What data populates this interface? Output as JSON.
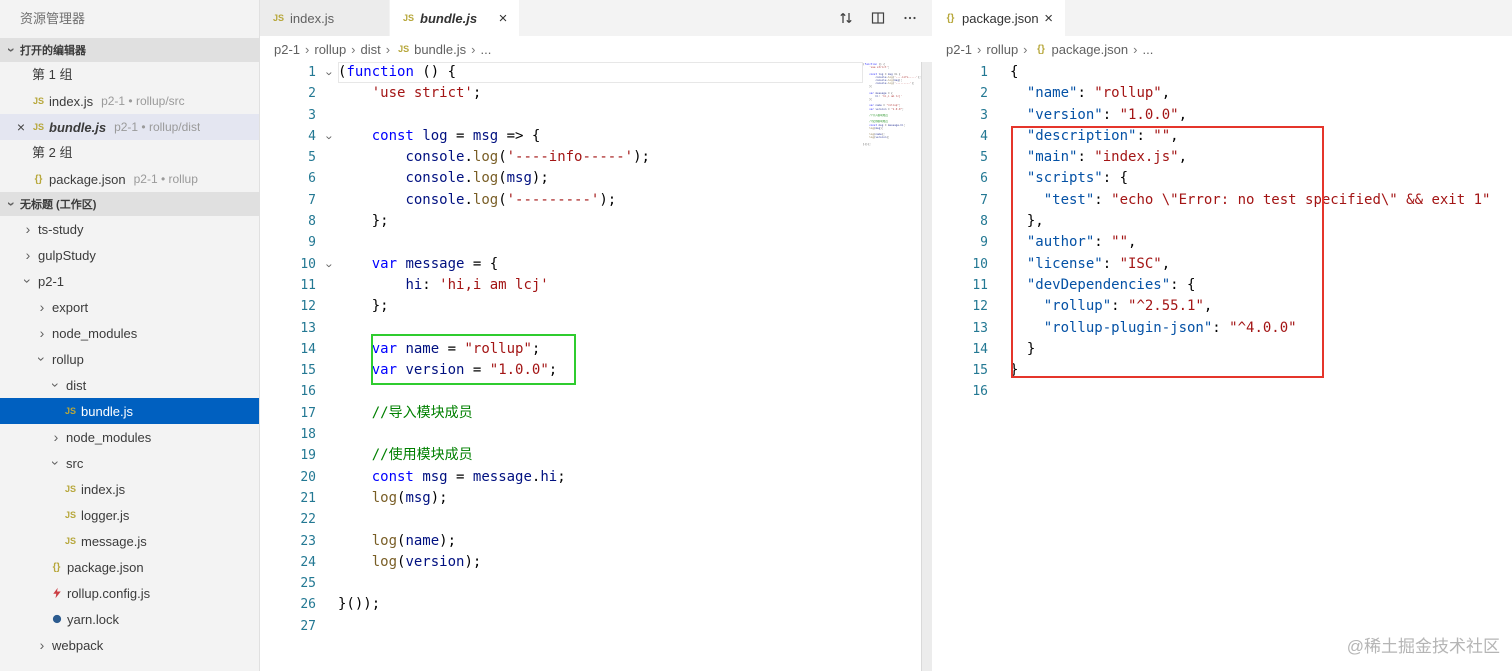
{
  "colors": {
    "accent": "#0060c0",
    "selected_row_bg": "#0060c0",
    "inactive_selection_bg": "#e4e6f1",
    "green_box": "#2fcc2f",
    "red_box": "#e5352b",
    "keyword": "#0000ff",
    "string": "#a31515",
    "identifier": "#001080",
    "function_call": "#795e26",
    "comment": "#008000",
    "json_key": "#0451a5",
    "line_number": "#237893"
  },
  "sidebar": {
    "title": "资源管理器",
    "open_editors": {
      "header": "打开的编辑器",
      "groups": [
        {
          "label": "第 1 组",
          "items": [
            {
              "icon": "js",
              "name": "index.js",
              "desc": "p2-1 • rollup/src",
              "close": false,
              "selected": false,
              "preview": false
            },
            {
              "icon": "js",
              "name": "bundle.js",
              "desc": "p2-1 • rollup/dist",
              "close": true,
              "selected": true,
              "preview": true
            }
          ]
        },
        {
          "label": "第 2 组",
          "items": [
            {
              "icon": "json",
              "name": "package.json",
              "desc": "p2-1 • rollup",
              "close": false,
              "selected": false,
              "preview": false
            }
          ]
        }
      ]
    },
    "workspace": {
      "header": "无标题 (工作区)",
      "tree": [
        {
          "type": "folder",
          "name": "ts-study",
          "depth": 0,
          "expanded": false
        },
        {
          "type": "folder",
          "name": "gulpStudy",
          "depth": 0,
          "expanded": false
        },
        {
          "type": "folder",
          "name": "p2-1",
          "depth": 0,
          "expanded": true
        },
        {
          "type": "folder",
          "name": "export",
          "depth": 1,
          "expanded": false
        },
        {
          "type": "folder",
          "name": "node_modules",
          "depth": 1,
          "expanded": false
        },
        {
          "type": "folder",
          "name": "rollup",
          "depth": 1,
          "expanded": true
        },
        {
          "type": "folder",
          "name": "dist",
          "depth": 2,
          "expanded": true
        },
        {
          "type": "file",
          "icon": "js",
          "name": "bundle.js",
          "depth": 3,
          "selected": true
        },
        {
          "type": "folder",
          "name": "node_modules",
          "depth": 2,
          "expanded": false
        },
        {
          "type": "folder",
          "name": "src",
          "depth": 2,
          "expanded": true
        },
        {
          "type": "file",
          "icon": "js",
          "name": "index.js",
          "depth": 3
        },
        {
          "type": "file",
          "icon": "js",
          "name": "logger.js",
          "depth": 3
        },
        {
          "type": "file",
          "icon": "js",
          "name": "message.js",
          "depth": 3
        },
        {
          "type": "file",
          "icon": "json",
          "name": "package.json",
          "depth": 2
        },
        {
          "type": "file",
          "icon": "rollup",
          "name": "rollup.config.js",
          "depth": 2
        },
        {
          "type": "file",
          "icon": "yarn",
          "name": "yarn.lock",
          "depth": 2
        },
        {
          "type": "folder",
          "name": "webpack",
          "depth": 1,
          "expanded": false
        }
      ]
    }
  },
  "editors": [
    {
      "tabs": [
        {
          "label": "index.js",
          "icon": "js",
          "active": false,
          "close": false,
          "preview": false
        },
        {
          "label": "bundle.js",
          "icon": "js",
          "active": true,
          "close": true,
          "preview": true
        }
      ],
      "tab_actions": [
        "toggle-layout-icon",
        "split-editor-icon",
        "more-actions-icon"
      ],
      "breadcrumb": [
        {
          "label": "p2-1"
        },
        {
          "label": "rollup"
        },
        {
          "label": "dist"
        },
        {
          "label": "bundle.js",
          "icon": "js"
        },
        {
          "label": "..."
        }
      ],
      "current_line": 1,
      "fold_lines": [
        1,
        4,
        10
      ],
      "code": [
        [
          [
            "p",
            "("
          ],
          [
            "k",
            "function"
          ],
          [
            "p",
            " () {"
          ]
        ],
        [
          [
            "p",
            "    "
          ],
          [
            "s",
            "'use strict'"
          ],
          [
            "p",
            ";"
          ]
        ],
        [],
        [
          [
            "p",
            "    "
          ],
          [
            "k",
            "const"
          ],
          [
            "p",
            " "
          ],
          [
            "i",
            "log"
          ],
          [
            "p",
            " = "
          ],
          [
            "i",
            "msg"
          ],
          [
            "p",
            " => {"
          ]
        ],
        [
          [
            "p",
            "        "
          ],
          [
            "i",
            "console"
          ],
          [
            "p",
            "."
          ],
          [
            "f",
            "log"
          ],
          [
            "p",
            "("
          ],
          [
            "s",
            "'----info-----'"
          ],
          [
            "p",
            ");"
          ]
        ],
        [
          [
            "p",
            "        "
          ],
          [
            "i",
            "console"
          ],
          [
            "p",
            "."
          ],
          [
            "f",
            "log"
          ],
          [
            "p",
            "("
          ],
          [
            "i",
            "msg"
          ],
          [
            "p",
            ");"
          ]
        ],
        [
          [
            "p",
            "        "
          ],
          [
            "i",
            "console"
          ],
          [
            "p",
            "."
          ],
          [
            "f",
            "log"
          ],
          [
            "p",
            "("
          ],
          [
            "s",
            "'---------'"
          ],
          [
            "p",
            ");"
          ]
        ],
        [
          [
            "p",
            "    };"
          ]
        ],
        [],
        [
          [
            "p",
            "    "
          ],
          [
            "k",
            "var"
          ],
          [
            "p",
            " "
          ],
          [
            "i",
            "message"
          ],
          [
            "p",
            " = {"
          ]
        ],
        [
          [
            "p",
            "        "
          ],
          [
            "i",
            "hi"
          ],
          [
            "p",
            ": "
          ],
          [
            "s",
            "'hi,i am lcj'"
          ]
        ],
        [
          [
            "p",
            "    };"
          ]
        ],
        [],
        [
          [
            "p",
            "    "
          ],
          [
            "k",
            "var"
          ],
          [
            "p",
            " "
          ],
          [
            "i",
            "name"
          ],
          [
            "p",
            " = "
          ],
          [
            "s",
            "\"rollup\""
          ],
          [
            "p",
            ";"
          ]
        ],
        [
          [
            "p",
            "    "
          ],
          [
            "k",
            "var"
          ],
          [
            "p",
            " "
          ],
          [
            "i",
            "version"
          ],
          [
            "p",
            " = "
          ],
          [
            "s",
            "\"1.0.0\""
          ],
          [
            "p",
            ";"
          ]
        ],
        [],
        [
          [
            "p",
            "    "
          ],
          [
            "c",
            "//导入模块成员"
          ]
        ],
        [],
        [
          [
            "p",
            "    "
          ],
          [
            "c",
            "//使用模块成员"
          ]
        ],
        [
          [
            "p",
            "    "
          ],
          [
            "k",
            "const"
          ],
          [
            "p",
            " "
          ],
          [
            "i",
            "msg"
          ],
          [
            "p",
            " = "
          ],
          [
            "i",
            "message"
          ],
          [
            "p",
            "."
          ],
          [
            "i",
            "hi"
          ],
          [
            "p",
            ";"
          ]
        ],
        [
          [
            "p",
            "    "
          ],
          [
            "f",
            "log"
          ],
          [
            "p",
            "("
          ],
          [
            "i",
            "msg"
          ],
          [
            "p",
            ");"
          ]
        ],
        [],
        [
          [
            "p",
            "    "
          ],
          [
            "f",
            "log"
          ],
          [
            "p",
            "("
          ],
          [
            "i",
            "name"
          ],
          [
            "p",
            ");"
          ]
        ],
        [
          [
            "p",
            "    "
          ],
          [
            "f",
            "log"
          ],
          [
            "p",
            "("
          ],
          [
            "i",
            "version"
          ],
          [
            "p",
            ");"
          ]
        ],
        [],
        [
          [
            "p",
            "}());"
          ]
        ],
        []
      ]
    },
    {
      "tabs": [
        {
          "label": "package.json",
          "icon": "json",
          "active": true,
          "close": true,
          "preview": false
        }
      ],
      "tab_actions": [],
      "breadcrumb": [
        {
          "label": "p2-1"
        },
        {
          "label": "rollup"
        },
        {
          "label": "package.json",
          "icon": "json"
        },
        {
          "label": "..."
        }
      ],
      "fold_lines": [],
      "code": [
        [
          [
            "p",
            "{"
          ]
        ],
        [
          [
            "p",
            "  "
          ],
          [
            "j",
            "\"name\""
          ],
          [
            "p",
            ": "
          ],
          [
            "s",
            "\"rollup\""
          ],
          [
            "p",
            ","
          ]
        ],
        [
          [
            "p",
            "  "
          ],
          [
            "j",
            "\"version\""
          ],
          [
            "p",
            ": "
          ],
          [
            "s",
            "\"1.0.0\""
          ],
          [
            "p",
            ","
          ]
        ],
        [
          [
            "p",
            "  "
          ],
          [
            "j",
            "\"description\""
          ],
          [
            "p",
            ": "
          ],
          [
            "s",
            "\"\""
          ],
          [
            "p",
            ","
          ]
        ],
        [
          [
            "p",
            "  "
          ],
          [
            "j",
            "\"main\""
          ],
          [
            "p",
            ": "
          ],
          [
            "s",
            "\"index.js\""
          ],
          [
            "p",
            ","
          ]
        ],
        [
          [
            "p",
            "  "
          ],
          [
            "j",
            "\"scripts\""
          ],
          [
            "p",
            ": {"
          ]
        ],
        [
          [
            "p",
            "    "
          ],
          [
            "j",
            "\"test\""
          ],
          [
            "p",
            ": "
          ],
          [
            "s",
            "\"echo \\\"Error: no test specified\\\" && exit 1\""
          ]
        ],
        [
          [
            "p",
            "  },"
          ]
        ],
        [
          [
            "p",
            "  "
          ],
          [
            "j",
            "\"author\""
          ],
          [
            "p",
            ": "
          ],
          [
            "s",
            "\"\""
          ],
          [
            "p",
            ","
          ]
        ],
        [
          [
            "p",
            "  "
          ],
          [
            "j",
            "\"license\""
          ],
          [
            "p",
            ": "
          ],
          [
            "s",
            "\"ISC\""
          ],
          [
            "p",
            ","
          ]
        ],
        [
          [
            "p",
            "  "
          ],
          [
            "j",
            "\"devDependencies\""
          ],
          [
            "p",
            ": {"
          ]
        ],
        [
          [
            "p",
            "    "
          ],
          [
            "j",
            "\"rollup\""
          ],
          [
            "p",
            ": "
          ],
          [
            "s",
            "\"^2.55.1\""
          ],
          [
            "p",
            ","
          ]
        ],
        [
          [
            "p",
            "    "
          ],
          [
            "j",
            "\"rollup-plugin-json\""
          ],
          [
            "p",
            ": "
          ],
          [
            "s",
            "\"^4.0.0\""
          ]
        ],
        [
          [
            "p",
            "  }"
          ]
        ],
        [
          [
            "p",
            "}"
          ]
        ],
        []
      ]
    }
  ],
  "watermark": "@稀土掘金技术社区"
}
